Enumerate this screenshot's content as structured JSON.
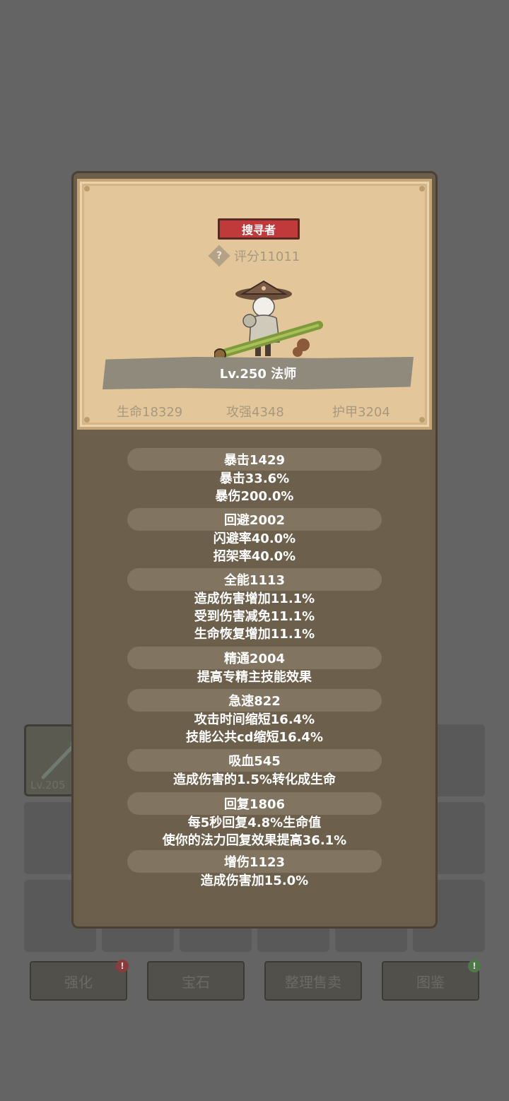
{
  "background": {
    "slot_level": "Lv.205",
    "buttons": [
      {
        "label": "强化",
        "badge": "!"
      },
      {
        "label": "宝石",
        "badge": ""
      },
      {
        "label": "整理售卖",
        "badge": ""
      },
      {
        "label": "图鉴",
        "badge": "!"
      }
    ]
  },
  "popup": {
    "class_tag": "搜寻者",
    "help_icon_glyph": "?",
    "score": "评分11011",
    "level_title": "Lv.250 法师",
    "base_stats": {
      "hp": "生命18329",
      "attack": "攻强4348",
      "armor": "护甲3204"
    },
    "stat_groups": [
      {
        "header": "暴击1429",
        "lines": [
          "暴击33.6%",
          "暴伤200.0%"
        ]
      },
      {
        "header": "回避2002",
        "lines": [
          "闪避率40.0%",
          "招架率40.0%"
        ]
      },
      {
        "header": "全能1113",
        "lines": [
          "造成伤害增加11.1%",
          "受到伤害减免11.1%",
          "生命恢复增加11.1%"
        ]
      },
      {
        "header": "精通2004",
        "lines": [
          "提高专精主技能效果"
        ]
      },
      {
        "header": "急速822",
        "lines": [
          "攻击时间缩短16.4%",
          "技能公共cd缩短16.4%"
        ]
      },
      {
        "header": "吸血545",
        "lines": [
          "造成伤害的1.5%转化成生命"
        ]
      },
      {
        "header": "回复1806",
        "lines": [
          "每5秒回复4.8%生命值",
          "使你的法力回复效果提高36.1%"
        ]
      },
      {
        "header": "增伤1123",
        "lines": [
          "造成伤害加15.0%"
        ]
      }
    ]
  },
  "colors": {
    "class_tag_bg": "#c0393b",
    "parchment": "#e3c69a",
    "panel_brown": "#6b5e4a",
    "badge_red": "#8a3b3b",
    "badge_green": "#4f7a48"
  }
}
